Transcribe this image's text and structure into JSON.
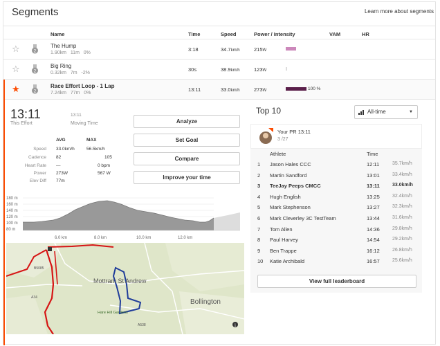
{
  "header": {
    "title": "Segments",
    "learn_more": "Learn more about segments"
  },
  "columns": {
    "name": "Name",
    "time": "Time",
    "speed": "Speed",
    "power": "Power / Intensity",
    "vam": "VAM",
    "hr": "HR"
  },
  "segments": [
    {
      "name": "The Hump",
      "distance": "1.90km",
      "elev": "11m",
      "grade": "0%",
      "time": "3:18",
      "speed": "34.7",
      "speed_unit": "km/h",
      "power": "215",
      "power_unit": "W",
      "intensity_pct": 0.5,
      "bar_color": "#cc88bb",
      "pct_label": ""
    },
    {
      "name": "Big Ring",
      "distance": "0.32km",
      "elev": "7m",
      "grade": "-2%",
      "time": "30s",
      "speed": "38.9",
      "speed_unit": "km/h",
      "power": "123",
      "power_unit": "W",
      "intensity_pct": 0.05,
      "bar_color": "#dddddd",
      "pct_label": ""
    },
    {
      "name": "Race Effort Loop - 1 Lap",
      "distance": "7.24km",
      "elev": "77m",
      "grade": "0%",
      "time": "13:11",
      "speed": "33.0",
      "speed_unit": "km/h",
      "power": "273",
      "power_unit": "W",
      "intensity_pct": 1.0,
      "bar_color": "#5a1f4a",
      "pct_label": "100 %"
    }
  ],
  "effort": {
    "time": "13:11",
    "time_label": "This Effort",
    "moving_time": "13:11",
    "moving_label": "Moving Time",
    "avg_label": "AVG",
    "max_label": "MAX",
    "stats": [
      {
        "label": "Speed",
        "avg": "33.0km/h",
        "max": "56.5km/h"
      },
      {
        "label": "Cadence",
        "avg": "82",
        "max": "105"
      },
      {
        "label": "Heart Rate",
        "avg": "—",
        "max": "0 bpm"
      },
      {
        "label": "Power",
        "avg": "273W",
        "max": "567 W"
      },
      {
        "label": "Elev Diff",
        "avg": "77m",
        "max": ""
      }
    ],
    "buttons": [
      "Analyze",
      "Set Goal",
      "Compare",
      "Improve your time"
    ]
  },
  "elevation": {
    "y_ticks": [
      "180 m",
      "160 m",
      "140 m",
      "120 m",
      "100 m",
      "80 m"
    ],
    "x_ticks": [
      "6.0 km",
      "8.0 km",
      "10.0 km",
      "12.0 km"
    ]
  },
  "map": {
    "labels": {
      "town1": "Mottram St Andrew",
      "town2": "Bollington",
      "place": "Hare Hill Gardens",
      "road1": "B5085",
      "road2": "A34",
      "road3": "A538"
    }
  },
  "top10": {
    "title": "Top 10",
    "filter": "All-time",
    "your_pr_label": "Your PR",
    "your_pr_time": "13:11",
    "your_pr_rank": "3 /27",
    "col_athlete": "Athlete",
    "col_time": "Time",
    "rows": [
      {
        "rank": "1",
        "name": "Jason Hales CCC",
        "time": "12:11",
        "speed": "35.7km/h"
      },
      {
        "rank": "2",
        "name": "Martin Sandford",
        "time": "13:01",
        "speed": "33.4km/h"
      },
      {
        "rank": "3",
        "name": "TeeJay Peeps CMCC",
        "time": "13:11",
        "speed": "33.0km/h"
      },
      {
        "rank": "4",
        "name": "Hugh English",
        "time": "13:25",
        "speed": "32.4km/h"
      },
      {
        "rank": "5",
        "name": "Mark Stephenson",
        "time": "13:27",
        "speed": "32.3km/h"
      },
      {
        "rank": "6",
        "name": "Mark Cleverley 3C TestTeam",
        "time": "13:44",
        "speed": "31.6km/h"
      },
      {
        "rank": "7",
        "name": "Tom Allen",
        "time": "14:36",
        "speed": "29.8km/h"
      },
      {
        "rank": "8",
        "name": "Paul Harvey",
        "time": "14:54",
        "speed": "29.2km/h"
      },
      {
        "rank": "9",
        "name": "Ben Trappe",
        "time": "16:12",
        "speed": "26.8km/h"
      },
      {
        "rank": "10",
        "name": "Katie Archibald",
        "time": "16:57",
        "speed": "25.6km/h"
      }
    ],
    "full_button": "View full leaderboard"
  }
}
